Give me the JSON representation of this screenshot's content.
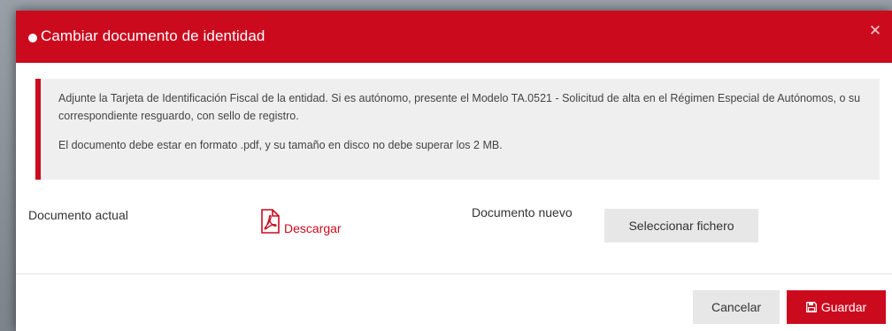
{
  "modal": {
    "title": "Cambiar documento de identidad",
    "close_icon": "close-icon",
    "accent_color": "#cc0a1e"
  },
  "info": {
    "paragraph1": "Adjunte la Tarjeta de Identificación Fiscal de la entidad. Si es autónomo, presente el Modelo TA.0521 - Solicitud de alta en el Régimen Especial de Autónomos, o su correspondiente resguardo, con sello de registro.",
    "paragraph2": "El documento debe estar en formato .pdf, y su tamaño en disco no debe superar los 2 MB."
  },
  "current_document": {
    "label": "Documento actual",
    "icon": "pdf-icon",
    "link_label": "Descargar"
  },
  "new_document": {
    "label": "Documento nuevo",
    "button_label": "Seleccionar fichero"
  },
  "footer": {
    "cancel_label": "Cancelar",
    "save_label": "Guardar",
    "save_icon": "floppy-disk-icon"
  }
}
